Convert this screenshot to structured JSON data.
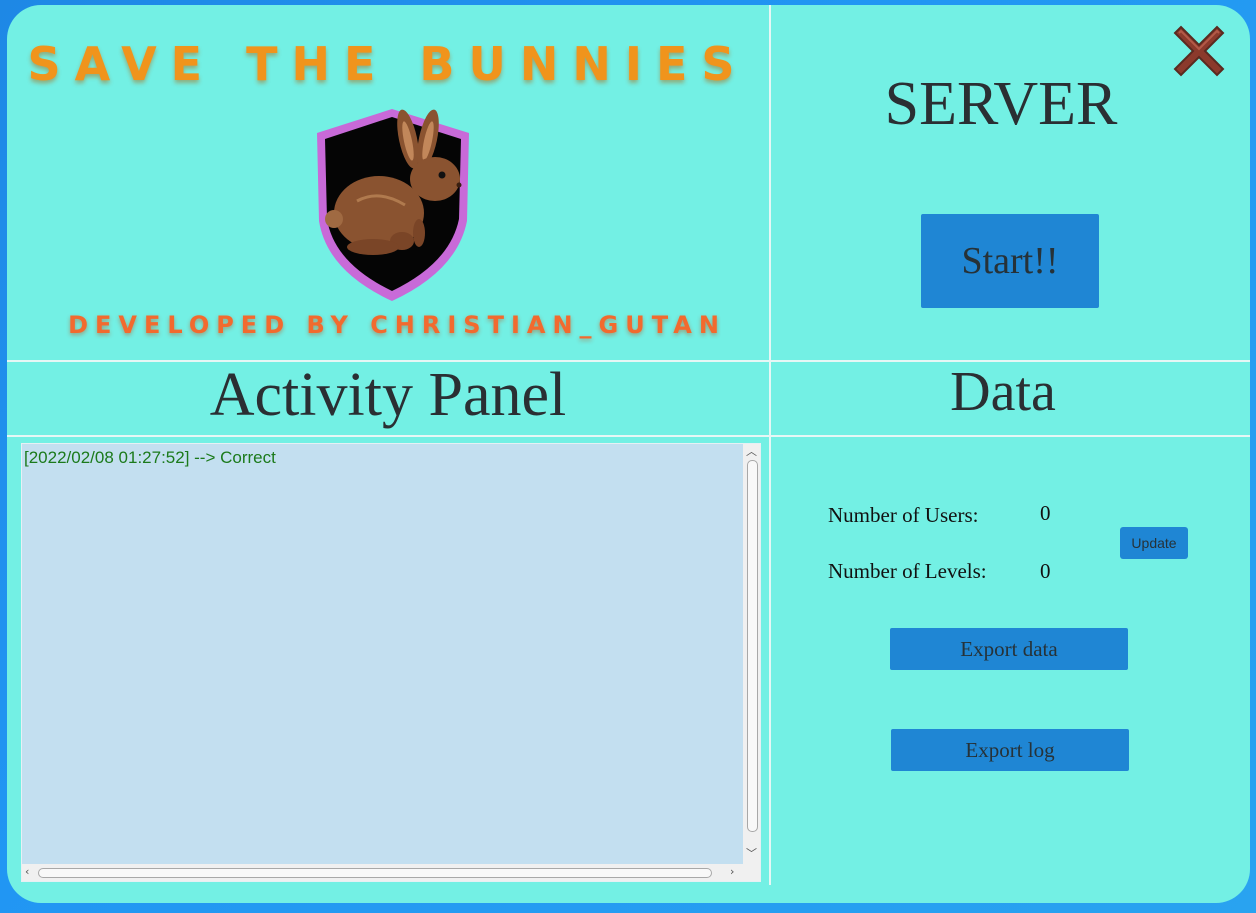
{
  "app": {
    "title_banner": "SAVE THE BUNNIES",
    "developer_banner": "DEVELOPED BY CHRISTIAN_GUTAN"
  },
  "server": {
    "title": "SERVER",
    "start_label": "Start!!"
  },
  "activity": {
    "title": "Activity Panel",
    "log": [
      "[2022/02/08 01:27:52] --> Correct"
    ]
  },
  "data_panel": {
    "title": "Data",
    "users_label": "Number of Users:",
    "users_value": "0",
    "levels_label": "Number of Levels:",
    "levels_value": "0",
    "update_label": "Update",
    "export_data_label": "Export data",
    "export_log_label": "Export log"
  },
  "icons": {
    "close": "close-icon",
    "logo": "bunny-shield-logo"
  },
  "colors": {
    "window_bg": "#73f0e4",
    "button_bg": "#1f86d4",
    "log_bg": "#c3dff0",
    "log_text": "#1b7a1b",
    "title_orange": "#f0941c"
  }
}
